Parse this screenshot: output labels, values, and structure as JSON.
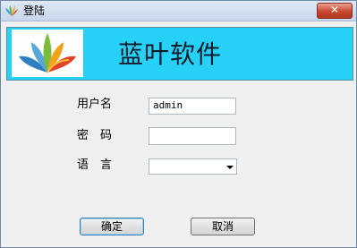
{
  "window": {
    "title": "登陆",
    "close_label": "✕"
  },
  "banner": {
    "title": "蓝叶软件"
  },
  "form": {
    "username_label": "用户名",
    "username_value": "admin",
    "password_label": "密　码",
    "password_value": "",
    "language_label": "语　言",
    "language_value": ""
  },
  "buttons": {
    "ok_label": "确定",
    "cancel_label": "取消"
  },
  "colors": {
    "banner_bg": "#26d0f6",
    "titlebar": "#c6d6ea",
    "close": "#c9482f"
  }
}
